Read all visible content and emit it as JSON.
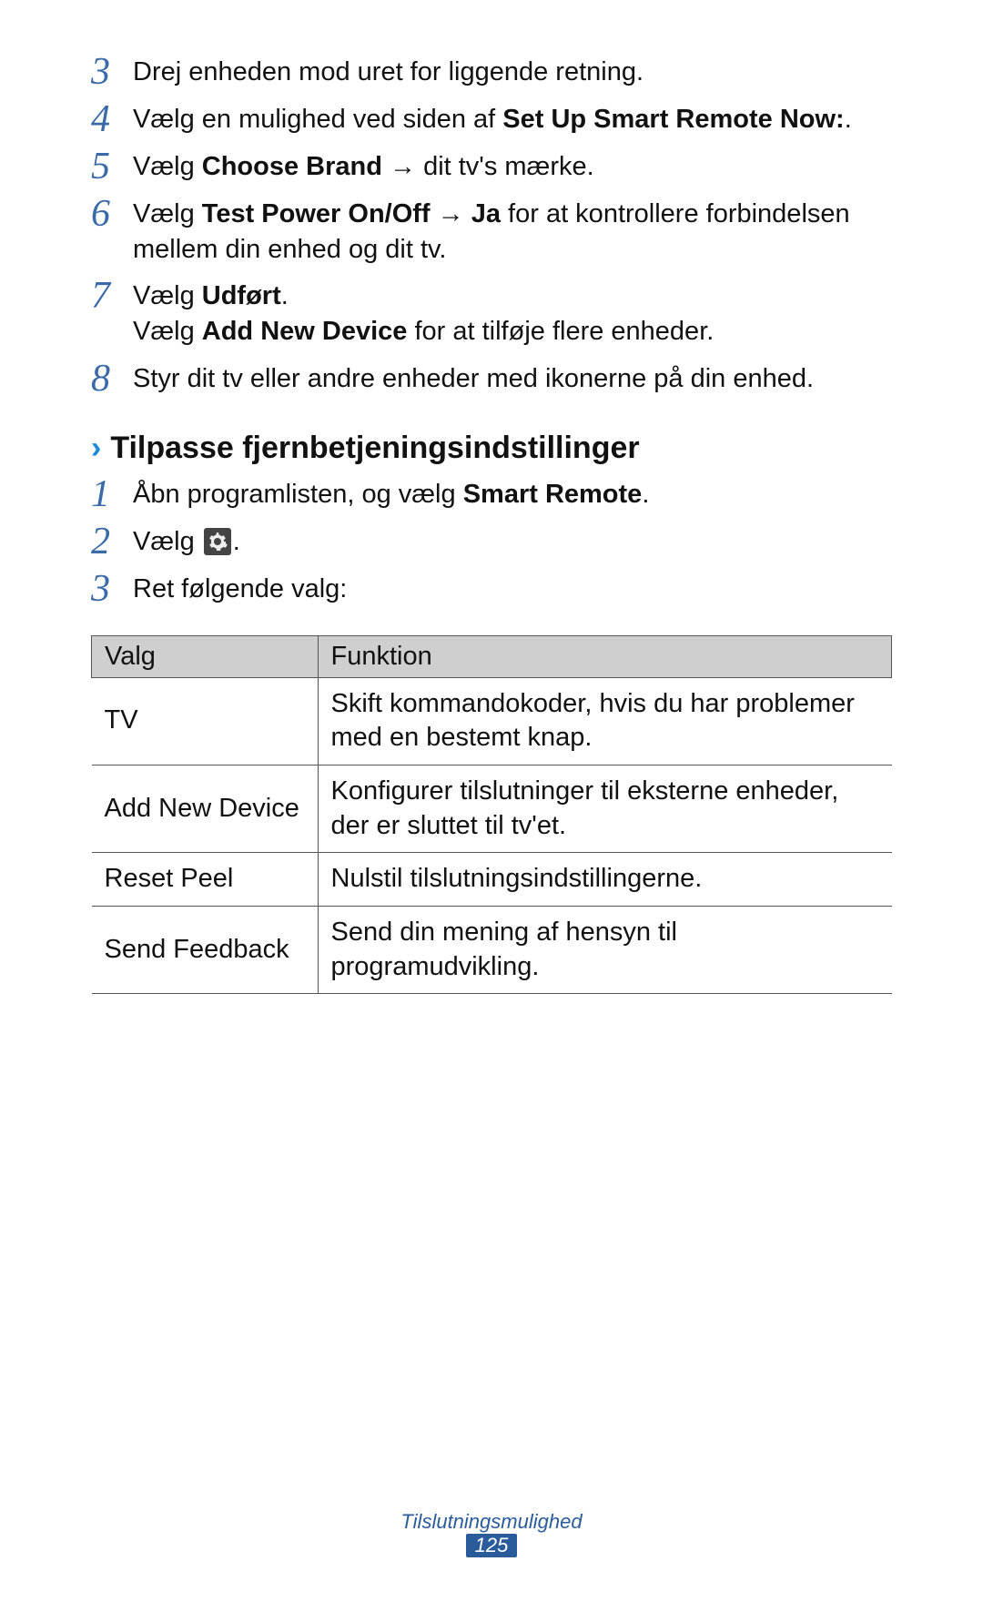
{
  "steps_a": [
    {
      "num": "3",
      "html": "Drej enheden mod uret for liggende retning."
    },
    {
      "num": "4",
      "html": "Vælg en mulighed ved siden af <span class=\"b\">Set Up Smart Remote Now:</span>."
    },
    {
      "num": "5",
      "html": "Vælg <span class=\"b\">Choose Brand</span> → dit tv's mærke."
    },
    {
      "num": "6",
      "html": "Vælg <span class=\"b\">Test Power On/Off</span> → <span class=\"b\">Ja</span> for at kontrollere forbindelsen mellem din enhed og dit tv."
    },
    {
      "num": "7",
      "html": "Vælg <span class=\"b\">Udført</span>.<span class=\"step-sub\">Vælg <span class=\"b\">Add New Device</span> for at tilføje flere enheder.</span>"
    },
    {
      "num": "8",
      "html": "Styr dit tv eller andre enheder med ikonerne på din enhed."
    }
  ],
  "section": {
    "chevron": "›",
    "title": "Tilpasse fjernbetjeningsindstillinger"
  },
  "steps_b": [
    {
      "num": "1",
      "html": "Åbn programlisten, og vælg <span class=\"b\">Smart Remote</span>."
    },
    {
      "num": "2",
      "html": "Vælg <span class=\"gear-icon\" data-name=\"settings-icon\" data-interactable=\"false\"><svg viewBox=\"0 0 24 24\"><path fill=\"#eee\" d=\"M12 8a4 4 0 1 0 0 8 4 4 0 0 0 0-8zm9 4c0 .6 0 1.2-.2 1.8l2 1.6-1.9 3.3-2.4-.8c-.9.7-1.9 1.3-3 1.6l-.4 2.5H11l-.4-2.5c-1.1-.3-2.1-.9-3-1.6l-2.4.8-1.9-3.3 2-1.6C5.1 13.2 5 12.6 5 12s0-1.2.2-1.8l-2-1.6 1.9-3.3 2.4.8c.9-.7 1.9-1.3 3-1.6L11 2h2.1l.4 2.5c1.1.3 2.1.9 3 1.6l2.4-.8 1.9 3.3-2 1.6c.2.6.2 1.2.2 1.8z\"/></svg></span>."
    },
    {
      "num": "3",
      "html": "Ret følgende valg:"
    }
  ],
  "table": {
    "headers": [
      "Valg",
      "Funktion"
    ],
    "rows": [
      [
        "TV",
        "Skift kommandokoder, hvis du har problemer med en bestemt knap."
      ],
      [
        "Add New Device",
        "Konfigurer tilslutninger til eksterne enheder, der er sluttet til tv'et."
      ],
      [
        "Reset Peel",
        "Nulstil tilslutningsindstillingerne."
      ],
      [
        "Send Feedback",
        "Send din mening af hensyn til programudvikling."
      ]
    ]
  },
  "footer": {
    "section": "Tilslutningsmulighed",
    "page": "125"
  }
}
